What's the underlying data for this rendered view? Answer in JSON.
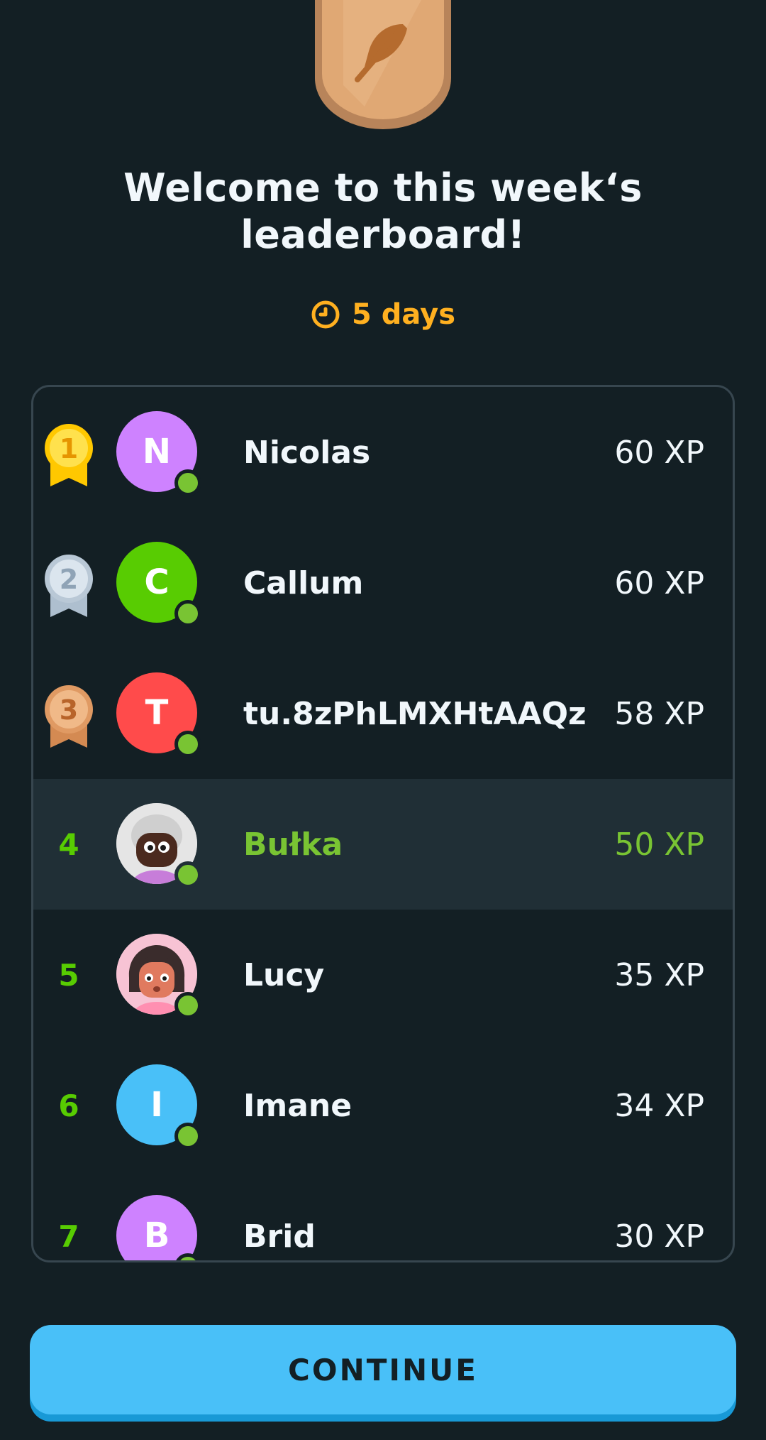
{
  "title_line1": "Welcome to this week‘s",
  "title_line2": "leaderboard!",
  "timer": {
    "text": "5 days",
    "icon": "clock-icon",
    "color": "#ffb020"
  },
  "league_badge": {
    "icon": "feather-icon",
    "tier": "Bronze"
  },
  "accent_green": "#79c433",
  "rows": [
    {
      "rank": "1",
      "medal": "gold",
      "initial": "N",
      "avatar_color": "#ce82ff",
      "name": "Nicolas",
      "xp": "60 XP"
    },
    {
      "rank": "2",
      "medal": "silver",
      "initial": "C",
      "avatar_color": "#58cc02",
      "name": "Callum",
      "xp": "60 XP"
    },
    {
      "rank": "3",
      "medal": "bronze",
      "initial": "T",
      "avatar_color": "#ff4b4b",
      "name": "tu.8zPhLMXHtAAQz",
      "xp": "58 XP"
    },
    {
      "rank": "4",
      "initial": "",
      "avatar": "character-avatar",
      "name": "Bułka",
      "xp": "50 XP",
      "current_user": true
    },
    {
      "rank": "5",
      "initial": "",
      "avatar": "character-avatar",
      "name": "Lucy",
      "xp": "35 XP"
    },
    {
      "rank": "6",
      "initial": "I",
      "avatar_color": "#49c0f8",
      "name": "Imane",
      "xp": "34 XP"
    },
    {
      "rank": "7",
      "initial": "B",
      "avatar_color": "#ce82ff",
      "name": "Brid",
      "xp": "30 XP"
    }
  ],
  "continue_label": "CONTINUE"
}
